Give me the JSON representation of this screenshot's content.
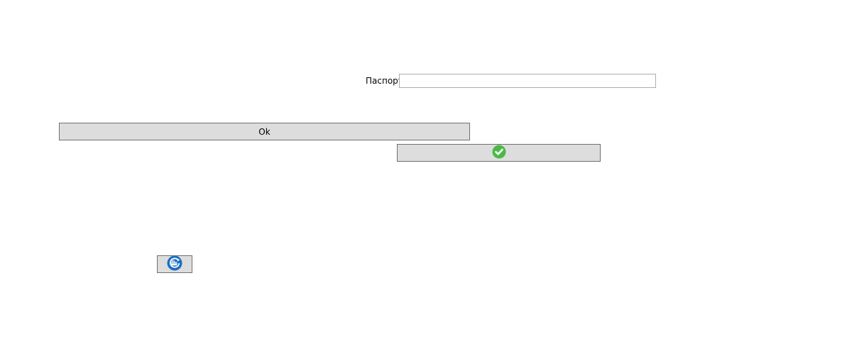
{
  "passport": {
    "label": "Паспорт",
    "value": "",
    "placeholder": ""
  },
  "buttons": {
    "ok_label": "Ok",
    "confirm_icon": "check-circle-icon",
    "ship_refresh_icon": "ship-refresh-icon"
  },
  "colors": {
    "button_bg": "#dddddd",
    "button_border": "#707070",
    "input_border": "#acacac",
    "check_green": "#4cb848",
    "icon_blue": "#1a6fc4"
  }
}
